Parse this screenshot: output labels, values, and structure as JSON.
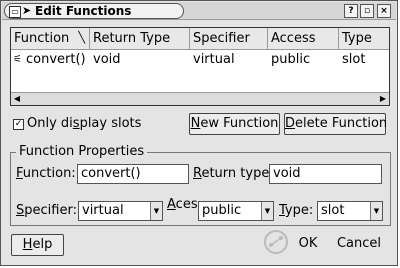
{
  "window": {
    "title": "Edit Functions",
    "help_btn": "?",
    "minimize_btn": "▫",
    "close_btn": "×"
  },
  "table": {
    "columns": [
      "Function",
      "Return Type",
      "Specifier",
      "Access",
      "Type"
    ],
    "rows": [
      {
        "function": "convert()",
        "return_type": "void",
        "specifier": "virtual",
        "access": "public",
        "type": "slot"
      }
    ]
  },
  "options": {
    "only_slots_label_pre": "Only di",
    "only_slots_label_u": "s",
    "only_slots_label_post": "play slots",
    "only_slots_checked_mark": "✓"
  },
  "buttons": {
    "new_function_u": "N",
    "new_function_rest": "ew Function",
    "delete_function_u": "D",
    "delete_function_rest": "elete Function",
    "help_u": "H",
    "help_rest": "elp",
    "ok": "OK",
    "cancel": "Cancel"
  },
  "properties": {
    "group_title": "Function Properties",
    "function_label_u": "F",
    "function_label_rest": "unction:",
    "function_value": "convert()",
    "return_type_label_u": "R",
    "return_type_label_rest": "eturn type:",
    "return_type_value": "void",
    "specifier_label_u": "S",
    "specifier_label_rest": "pecifier:",
    "specifier_value": "virtual",
    "access_label_u": "A",
    "access_label_rest": "ces",
    "access_value": "public",
    "type_label_u": "T",
    "type_label_rest": "ype:",
    "type_value": "slot"
  },
  "icons": {
    "sort": "sort-indicator-icon",
    "slot": "slot-icon",
    "watermark": "watermark-logo"
  }
}
